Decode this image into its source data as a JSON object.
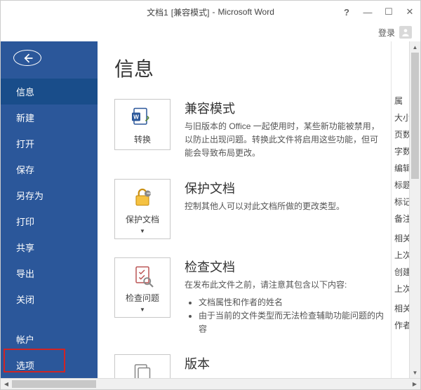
{
  "titlebar": {
    "doc_name": "文档1",
    "mode": "[兼容模式]",
    "app": "Microsoft Word",
    "sep": " - "
  },
  "signin": {
    "label": "登录"
  },
  "sidebar": {
    "items": [
      {
        "key": "info",
        "label": "信息",
        "active": true
      },
      {
        "key": "new",
        "label": "新建"
      },
      {
        "key": "open",
        "label": "打开"
      },
      {
        "key": "save",
        "label": "保存"
      },
      {
        "key": "saveas",
        "label": "另存为"
      },
      {
        "key": "print",
        "label": "打印"
      },
      {
        "key": "share",
        "label": "共享"
      },
      {
        "key": "export",
        "label": "导出"
      },
      {
        "key": "close",
        "label": "关闭"
      }
    ],
    "bottom": [
      {
        "key": "account",
        "label": "帐户"
      },
      {
        "key": "options",
        "label": "选项"
      }
    ]
  },
  "page": {
    "title": "信息"
  },
  "sections": {
    "compat": {
      "button": "转换",
      "heading": "兼容模式",
      "desc": "与旧版本的 Office 一起使用时，某些新功能被禁用，以防止出现问题。转换此文件将启用这些功能，但可能会导致布局更改。"
    },
    "protect": {
      "button": "保护文档",
      "heading": "保护文档",
      "desc": "控制其他人可以对此文档所做的更改类型。"
    },
    "inspect": {
      "button": "检查问题",
      "heading": "检查文档",
      "desc": "在发布此文件之前，请注意其包含以下内容:",
      "bullets": [
        "文档属性和作者的姓名",
        "由于当前的文件类型而无法检查辅助功能问题的内容"
      ]
    },
    "versions": {
      "heading": "版本"
    }
  },
  "props": {
    "header1": "属",
    "rows1": [
      "大小",
      "页数",
      "字数",
      "编辑",
      "标题",
      "标记",
      "备注"
    ],
    "header2": "相关",
    "rows2": [
      "上次",
      "创建",
      "上次"
    ],
    "header3": "相关",
    "rows3": [
      "作者"
    ]
  }
}
